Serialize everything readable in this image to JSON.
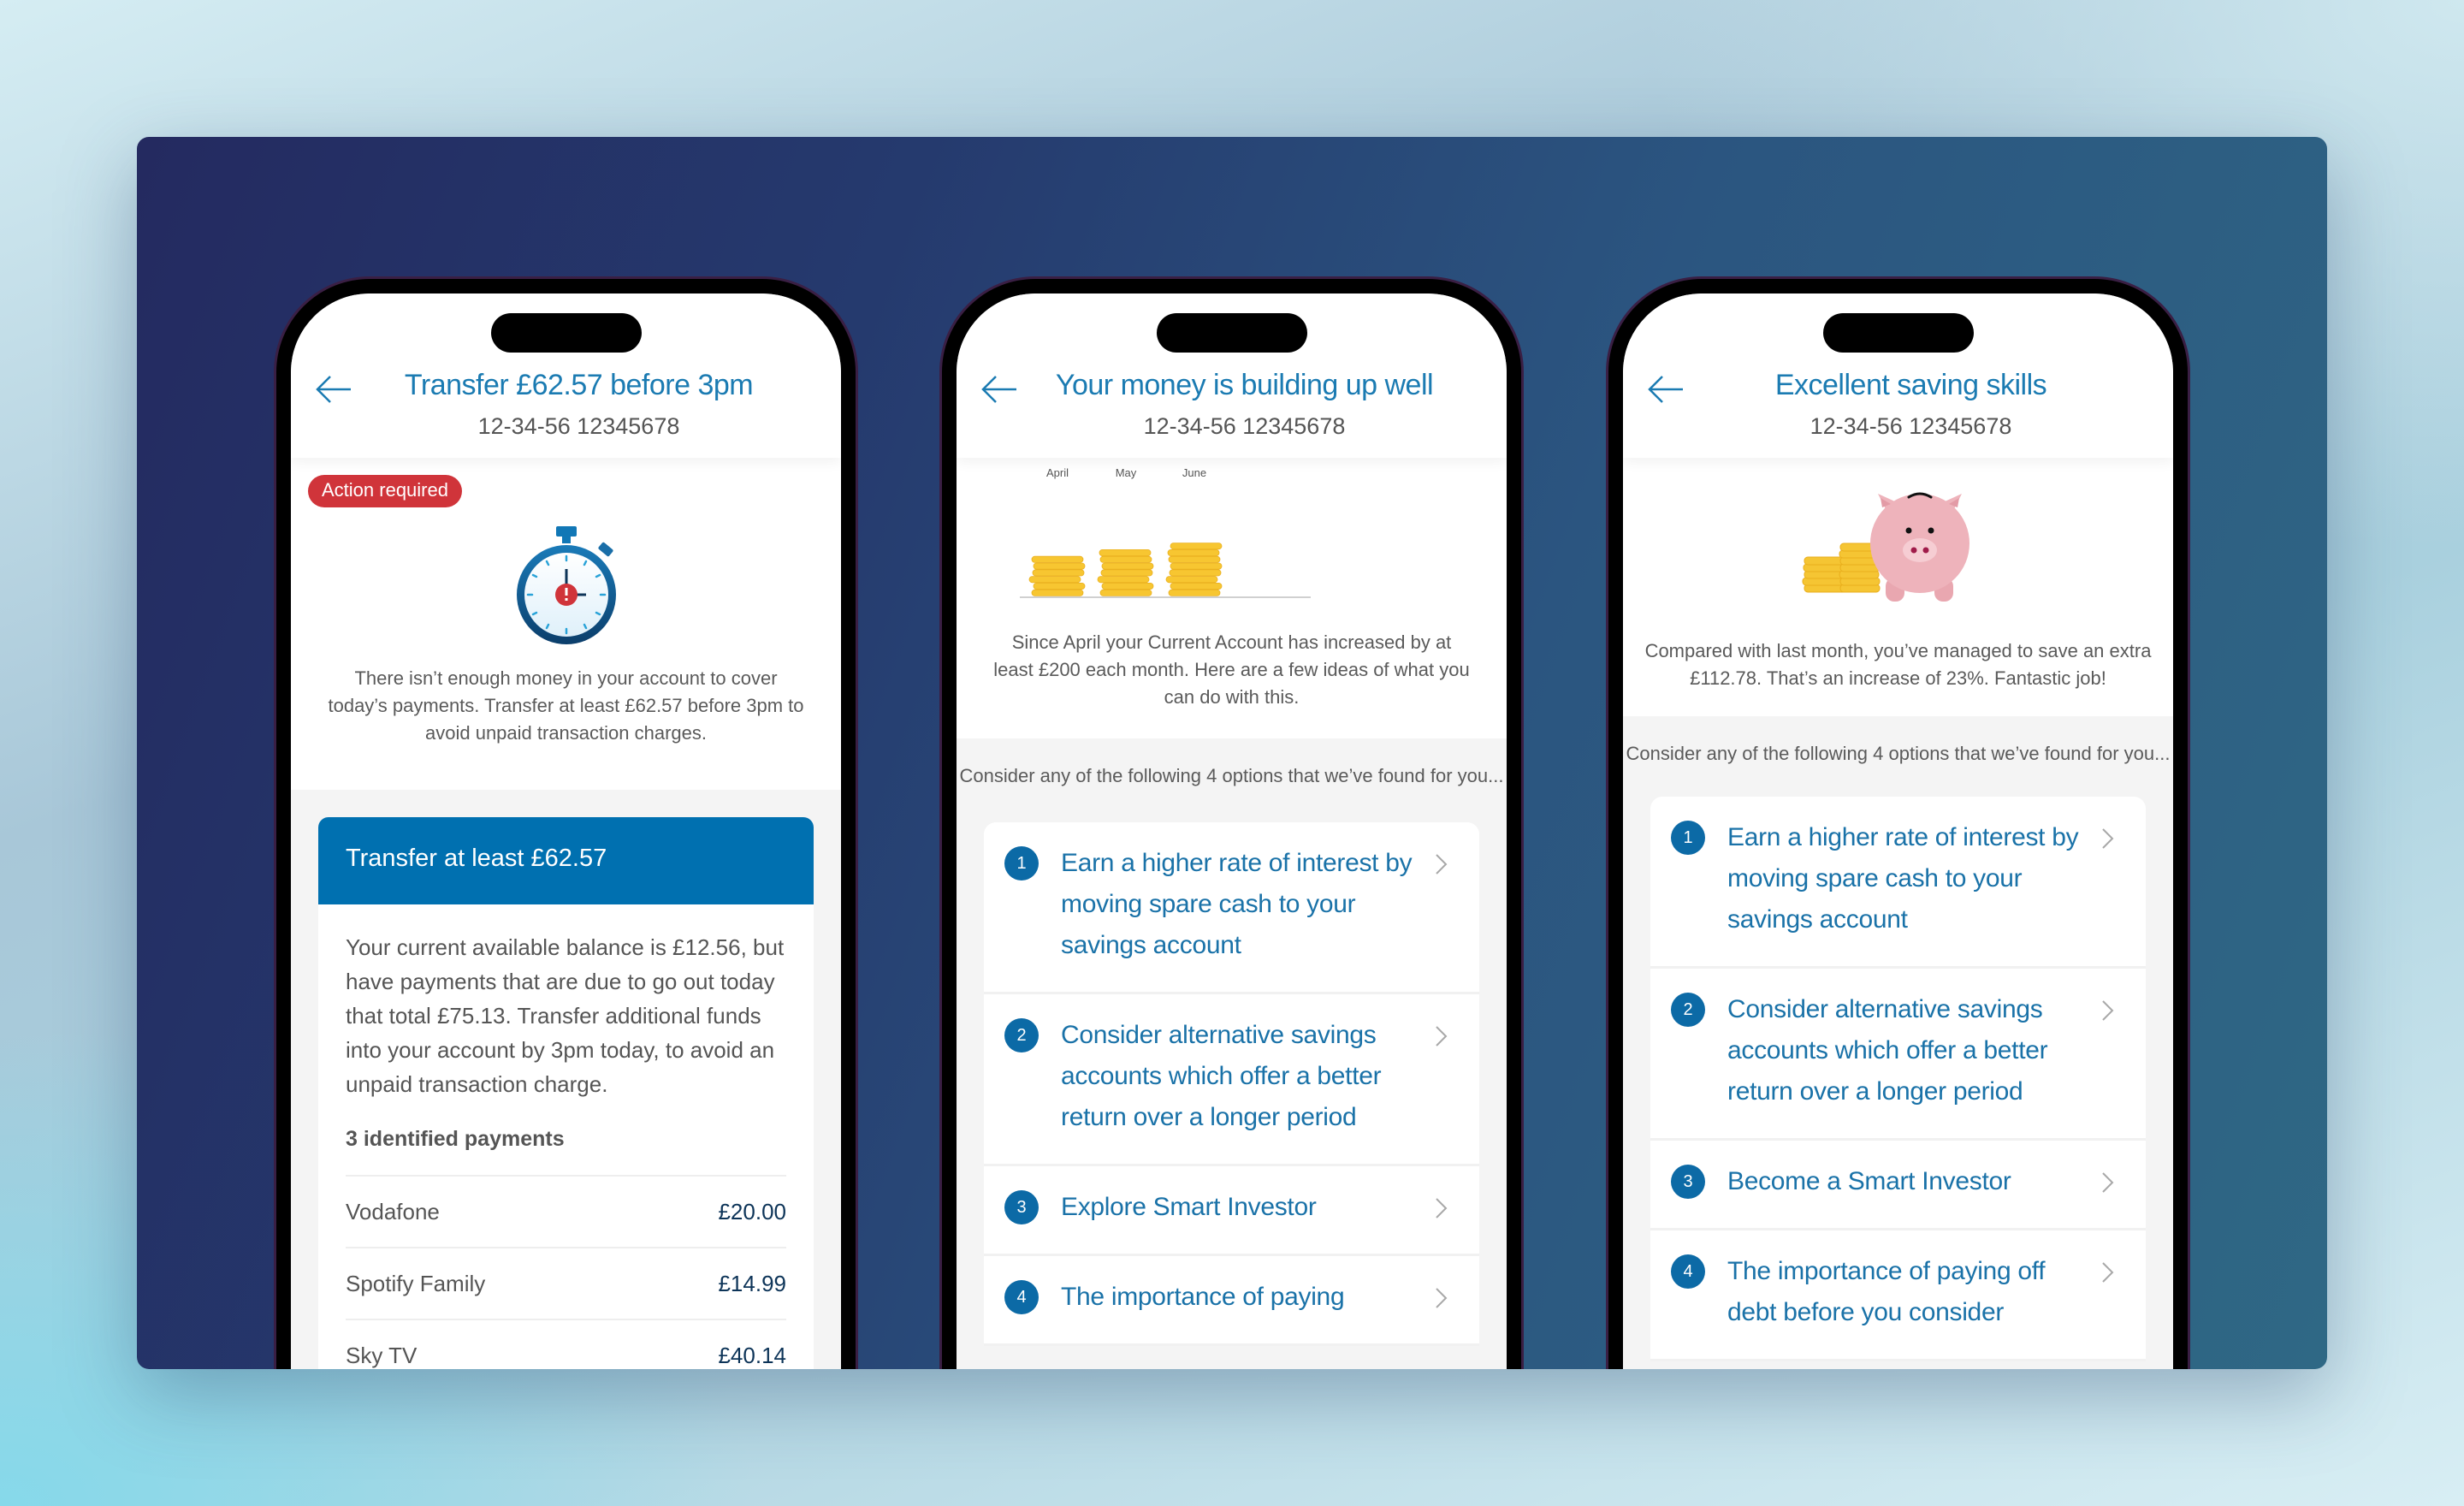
{
  "colors": {
    "brand_blue": "#0070b0",
    "title_blue": "#1b7bb2",
    "badge_red": "#d0343a",
    "coin_gold": "#f5c533",
    "pig_pink": "#eeb3bb"
  },
  "phones": [
    {
      "header": {
        "back_icon": "arrow-left-icon",
        "title": "Transfer £62.57 before 3pm",
        "account": "12-34-56  12345678"
      },
      "badge": "Action required",
      "illustration": "stopwatch-icon",
      "message": "There isn’t enough money in your account to cover today’s payments. Transfer at least £62.57 before 3pm to avoid unpaid transaction charges.",
      "card": {
        "title": "Transfer at least £62.57",
        "body": "Your current available balance is £12.56, but have payments that are due to go out today that total £75.13. Transfer additional funds into your account by 3pm today, to avoid an unpaid transaction charge.",
        "payments_heading": "3 identified payments",
        "payments": [
          {
            "name": "Vodafone",
            "amount": "£20.00"
          },
          {
            "name": "Spotify Family",
            "amount": "£14.99"
          },
          {
            "name": "Sky TV",
            "amount": "£40.14"
          }
        ]
      }
    },
    {
      "header": {
        "back_icon": "arrow-left-icon",
        "title": "Your money is building up well",
        "account": "12-34-56  12345678"
      },
      "coin_chart": {
        "months": [
          "April",
          "May",
          "June"
        ],
        "coin_counts": [
          6,
          7,
          8
        ]
      },
      "message": "Since April your Current Account has increased by at least £200 each month. Here are a few ideas of what you can do with this.",
      "intro": "Consider any of the following 4 options that we’ve found for you...",
      "options": [
        {
          "number": "1",
          "label": "Earn a higher rate of interest by moving spare cash to your savings account"
        },
        {
          "number": "2",
          "label": "Consider alternative savings accounts which offer a better return over a longer period"
        },
        {
          "number": "3",
          "label": "Explore Smart Investor"
        },
        {
          "number": "4",
          "label": "The importance of paying"
        }
      ]
    },
    {
      "header": {
        "back_icon": "arrow-left-icon",
        "title": "Excellent saving skills",
        "account": "12-34-56  12345678"
      },
      "illustration": "piggy-bank-icon",
      "message": "Compared with last month, you’ve managed to save an extra £112.78. That’s an increase of 23%. Fantastic job!",
      "intro": "Consider any of the following 4 options that we’ve found for you...",
      "options": [
        {
          "number": "1",
          "label": "Earn a higher rate of interest by moving spare cash to your savings account"
        },
        {
          "number": "2",
          "label": "Consider alternative savings accounts which offer a better return over a longer period"
        },
        {
          "number": "3",
          "label": "Become a Smart Investor"
        },
        {
          "number": "4",
          "label": "The importance of paying off debt before you consider"
        }
      ]
    }
  ]
}
